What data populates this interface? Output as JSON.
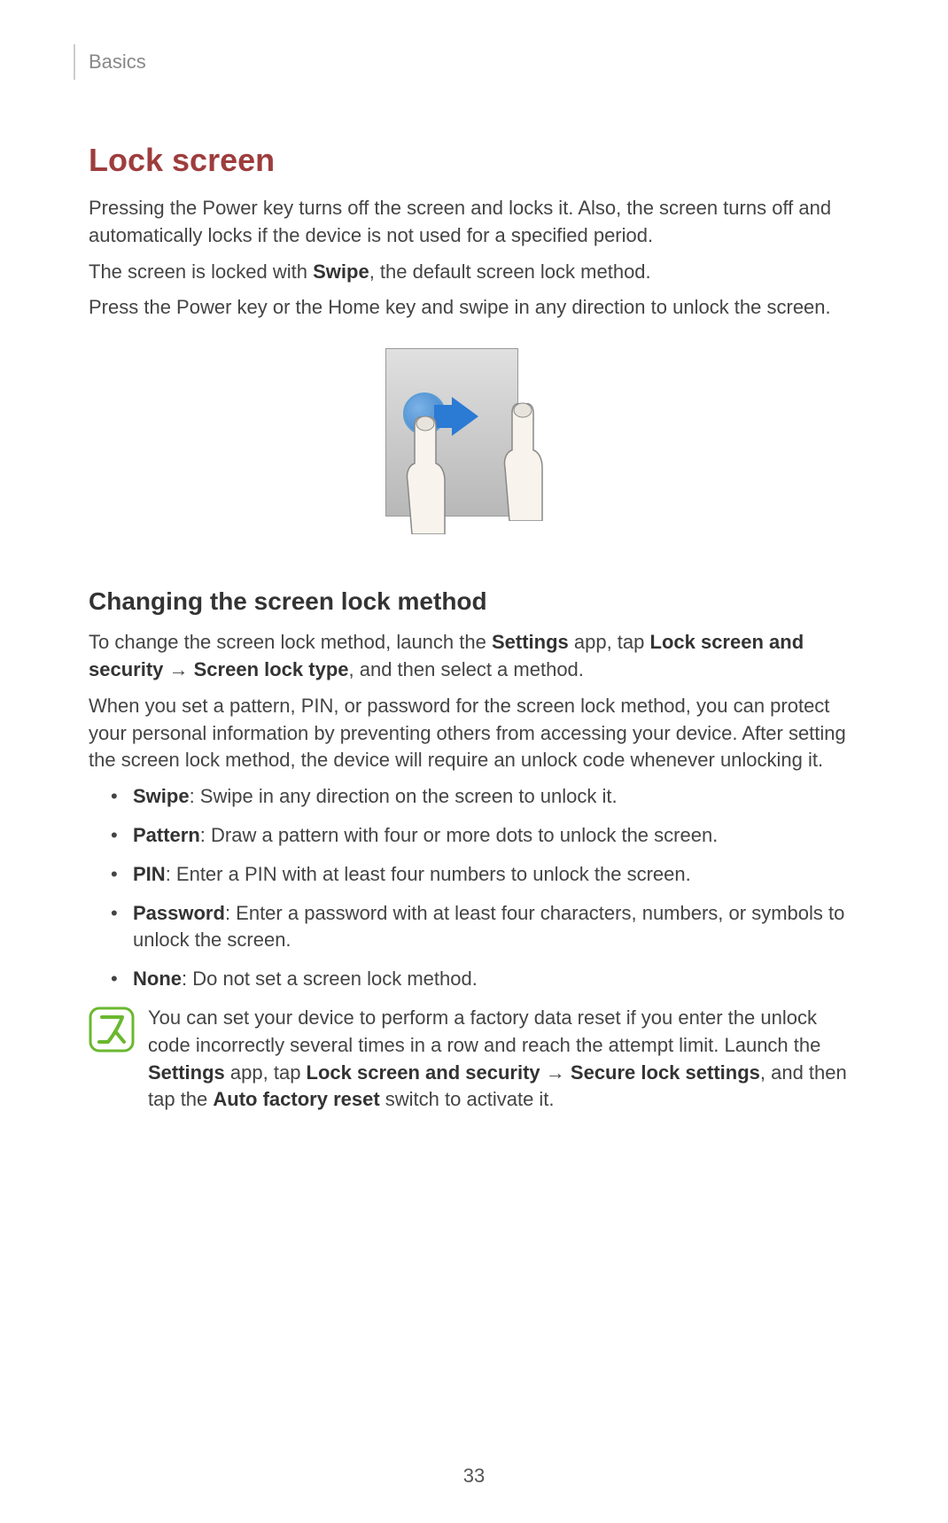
{
  "header": {
    "section": "Basics"
  },
  "title": "Lock screen",
  "intro": {
    "para1": "Pressing the Power key turns off the screen and locks it. Also, the screen turns off and automatically locks if the device is not used for a specified period.",
    "para2_before": "The screen is locked with ",
    "para2_bold": "Swipe",
    "para2_after": ", the default screen lock method.",
    "para3": "Press the Power key or the Home key and swipe in any direction to unlock the screen."
  },
  "section2": {
    "heading": "Changing the screen lock method",
    "para1_parts": {
      "t1": "To change the screen lock method, launch the ",
      "b1": "Settings",
      "t2": " app, tap ",
      "b2": "Lock screen and security",
      "t3": " → ",
      "b3": "Screen lock type",
      "t4": ", and then select a method."
    },
    "para2": "When you set a pattern, PIN, or password for the screen lock method, you can protect your personal information by preventing others from accessing your device. After setting the screen lock method, the device will require an unlock code whenever unlocking it."
  },
  "bullets": [
    {
      "bold": "Swipe",
      "text": ": Swipe in any direction on the screen to unlock it."
    },
    {
      "bold": "Pattern",
      "text": ": Draw a pattern with four or more dots to unlock the screen."
    },
    {
      "bold": "PIN",
      "text": ": Enter a PIN with at least four numbers to unlock the screen."
    },
    {
      "bold": "Password",
      "text": ": Enter a password with at least four characters, numbers, or symbols to unlock the screen."
    },
    {
      "bold": "None",
      "text": ": Do not set a screen lock method."
    }
  ],
  "note": {
    "t1": "You can set your device to perform a factory data reset if you enter the unlock code incorrectly several times in a row and reach the attempt limit. Launch the ",
    "b1": "Settings",
    "t2": " app, tap ",
    "b2": "Lock screen and security",
    "t3": " → ",
    "b3": "Secure lock settings",
    "t4": ", and then tap the ",
    "b4": "Auto factory reset",
    "t5": " switch to activate it."
  },
  "page_number": "33"
}
